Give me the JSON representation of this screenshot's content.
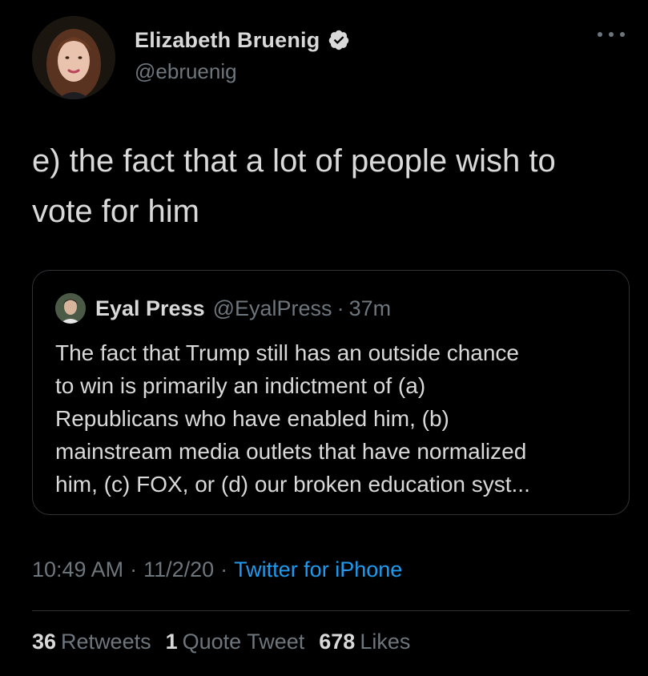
{
  "author": {
    "display_name": "Elizabeth Bruenig",
    "handle": "@ebruenig",
    "verified": true
  },
  "tweet": {
    "text_line1": "e) the fact that a lot of people wish to",
    "text_line2": "vote for him"
  },
  "quoted_tweet": {
    "display_name": "Eyal Press",
    "handle": "@EyalPress",
    "separator": "·",
    "time": "37m",
    "lines": [
      "The fact that Trump still has an outside chance",
      "to win is primarily an indictment of (a)",
      "Republicans who have enabled him, (b)",
      "mainstream media outlets that have normalized",
      "him, (c) FOX, or (d) our broken education syst..."
    ]
  },
  "meta": {
    "time": "10:49 AM",
    "separator": "·",
    "date": "11/2/20",
    "source": "Twitter for iPhone"
  },
  "stats": {
    "retweets_count": "36",
    "retweets_label": "Retweets",
    "quotes_count": "1",
    "quotes_label": "Quote Tweet",
    "likes_count": "678",
    "likes_label": "Likes"
  },
  "colors": {
    "background": "#000000",
    "text": "#d9d9d9",
    "secondary": "#6e767d",
    "link": "#1d9bf0",
    "border": "#2f3336"
  },
  "icons": {
    "verified": "verified-badge-icon",
    "more": "more-dots-icon"
  }
}
